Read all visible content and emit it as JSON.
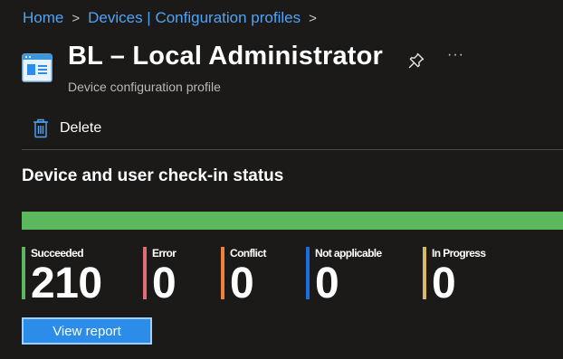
{
  "breadcrumb": {
    "items": [
      "Home",
      "Devices | Configuration profiles"
    ],
    "separator": ">"
  },
  "header": {
    "title": "BL – Local Administrator",
    "subtitle": "Device configuration profile",
    "more_label": "···"
  },
  "toolbar": {
    "delete_label": "Delete"
  },
  "status": {
    "heading": "Device and user check-in status",
    "succeeded_fraction": 1.0,
    "bar_color": "#5cb85c",
    "items": [
      {
        "label": "Succeeded",
        "value": "210",
        "color": "#5cb85c"
      },
      {
        "label": "Error",
        "value": "0",
        "color": "#e06c75"
      },
      {
        "label": "Conflict",
        "value": "0",
        "color": "#f0813a"
      },
      {
        "label": "Not applicable",
        "value": "0",
        "color": "#1a6fe0"
      },
      {
        "label": "In Progress",
        "value": "0",
        "color": "#d4bb63"
      }
    ]
  },
  "actions": {
    "view_report_label": "View report"
  },
  "colors": {
    "link": "#4fa3f7",
    "accent": "#2b8cea",
    "background": "#1b1a19"
  }
}
